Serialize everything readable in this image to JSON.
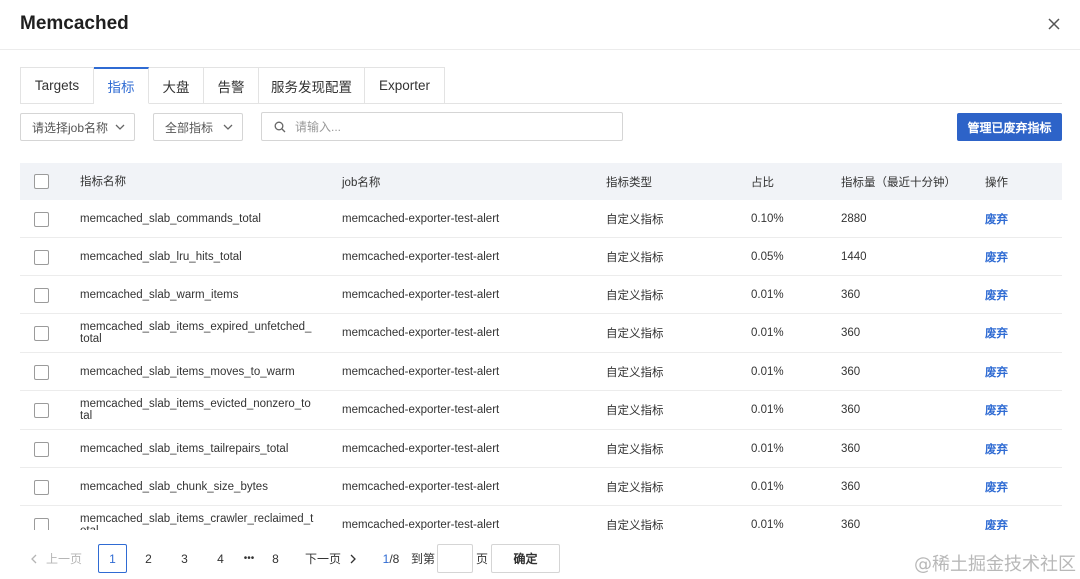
{
  "modal": {
    "title": "Memcached"
  },
  "tabs": [
    {
      "label": "Targets",
      "active": false
    },
    {
      "label": "指标",
      "active": true
    },
    {
      "label": "大盘",
      "active": false
    },
    {
      "label": "告警",
      "active": false
    },
    {
      "label": "服务发现配置",
      "active": false
    },
    {
      "label": "Exporter",
      "active": false
    }
  ],
  "filters": {
    "job_select": "请选择job名称",
    "metric_select": "全部指标",
    "search_placeholder": "请输入..."
  },
  "actions": {
    "manage_label": "管理已废弃指标"
  },
  "table": {
    "headers": {
      "name": "指标名称",
      "job": "job名称",
      "type": "指标类型",
      "ratio": "占比",
      "count": "指标量（最近十分钟）",
      "op": "操作"
    },
    "rows": [
      {
        "name": "memcached_slab_commands_total",
        "job": "memcached-exporter-test-alert",
        "type": "自定义指标",
        "ratio": "0.10%",
        "count": "2880",
        "op": "废弃"
      },
      {
        "name": "memcached_slab_lru_hits_total",
        "job": "memcached-exporter-test-alert",
        "type": "自定义指标",
        "ratio": "0.05%",
        "count": "1440",
        "op": "废弃"
      },
      {
        "name": "memcached_slab_warm_items",
        "job": "memcached-exporter-test-alert",
        "type": "自定义指标",
        "ratio": "0.01%",
        "count": "360",
        "op": "废弃"
      },
      {
        "name": "memcached_slab_items_expired_unfetched_\ntotal",
        "job": "memcached-exporter-test-alert",
        "type": "自定义指标",
        "ratio": "0.01%",
        "count": "360",
        "op": "废弃"
      },
      {
        "name": "memcached_slab_items_moves_to_warm",
        "job": "memcached-exporter-test-alert",
        "type": "自定义指标",
        "ratio": "0.01%",
        "count": "360",
        "op": "废弃"
      },
      {
        "name": "memcached_slab_items_evicted_nonzero_to\ntal",
        "job": "memcached-exporter-test-alert",
        "type": "自定义指标",
        "ratio": "0.01%",
        "count": "360",
        "op": "废弃"
      },
      {
        "name": "memcached_slab_items_tailrepairs_total",
        "job": "memcached-exporter-test-alert",
        "type": "自定义指标",
        "ratio": "0.01%",
        "count": "360",
        "op": "废弃"
      },
      {
        "name": "memcached_slab_chunk_size_bytes",
        "job": "memcached-exporter-test-alert",
        "type": "自定义指标",
        "ratio": "0.01%",
        "count": "360",
        "op": "废弃"
      },
      {
        "name": "memcached_slab_items_crawler_reclaimed_t\notal",
        "job": "memcached-exporter-test-alert",
        "type": "自定义指标",
        "ratio": "0.01%",
        "count": "360",
        "op": "废弃"
      }
    ]
  },
  "pagination": {
    "prev": "上一页",
    "pages": [
      "1",
      "2",
      "3",
      "4"
    ],
    "ellipsis": "•••",
    "last_page": "8",
    "next": "下一页",
    "current": "1",
    "total": "/8",
    "goto_label": "到第",
    "page_unit": "页",
    "confirm": "确定"
  },
  "watermark": "@稀土掘金技术社区",
  "colors": {
    "accent": "#2f6bd3",
    "primary_button": "#2d63c8",
    "header_bg": "#f1f3f7"
  }
}
